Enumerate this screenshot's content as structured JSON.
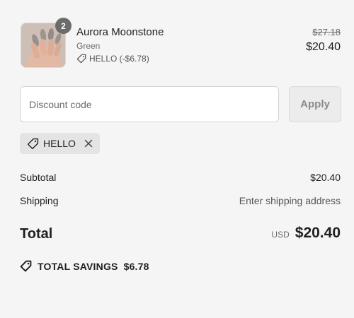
{
  "line_item": {
    "quantity": "2",
    "name": "Aurora Moonstone",
    "variant": "Green",
    "discount_applied": "HELLO (-$6.78)",
    "original_price": "$27.18",
    "price": "$20.40",
    "thumbnail_icon": "nails-product-photo"
  },
  "discount": {
    "placeholder": "Discount code",
    "apply_label": "Apply",
    "applied_code": "HELLO"
  },
  "summary": {
    "subtotal_label": "Subtotal",
    "subtotal_value": "$20.40",
    "shipping_label": "Shipping",
    "shipping_value": "Enter shipping address",
    "total_label": "Total",
    "currency": "USD",
    "total_value": "$20.40",
    "savings_label": "TOTAL SAVINGS",
    "savings_value": "$6.78"
  },
  "colors": {
    "background": "#f5f5f5",
    "text": "#1f1f1f",
    "muted": "#6b6b6b",
    "chip": "#e4e4e4"
  }
}
